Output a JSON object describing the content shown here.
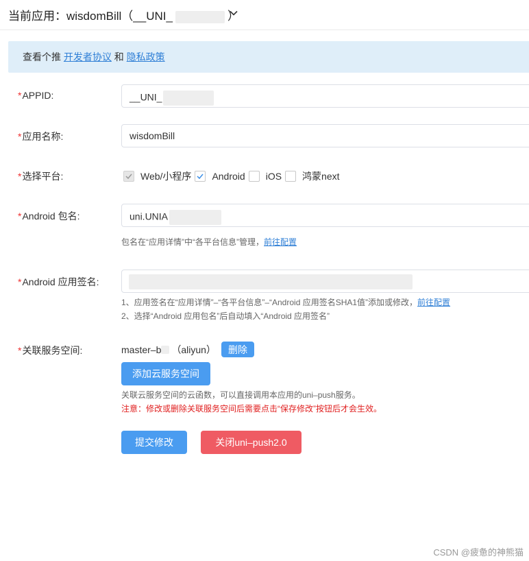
{
  "header": {
    "title_prefix": "当前应用：wisdomBill（__UNI_",
    "title_suffix": "）"
  },
  "notice": {
    "text": "查看个推",
    "link1": "开发者协议",
    "and": "和",
    "link2": "隐私政策"
  },
  "form": {
    "appid": {
      "label": "APPID:",
      "value": "__UNI_"
    },
    "app_name": {
      "label": "应用名称:",
      "value": "wisdomBill"
    },
    "platform": {
      "label": "选择平台:",
      "options": [
        {
          "label": "Web/小程序",
          "state": "checked-disabled"
        },
        {
          "label": "Android",
          "state": "checked"
        },
        {
          "label": "iOS",
          "state": "unchecked"
        },
        {
          "label": "鸿蒙next",
          "state": "unchecked"
        }
      ]
    },
    "package": {
      "label": "Android 包名:",
      "value": "uni.UNIA",
      "hint_text": "包名在“应用详情”中“各平台信息”管理，",
      "hint_link": "前往配置"
    },
    "signature": {
      "label": "Android 应用签名:",
      "hint1_text": "1、应用签名在“应用详情”–“各平台信息”–“Android 应用签名SHA1值”添加或修改，",
      "hint1_link": "前往配置",
      "hint2_text": "2、选择“Android 应用包名”后自动填入“Android 应用签名”"
    },
    "service_space": {
      "label": "关联服务空间:",
      "name_prefix": "master–b",
      "provider": "（aliyun）",
      "delete_label": "删除",
      "add_label": "添加云服务空间",
      "hint": "关联云服务空间的云函数，可以直接调用本应用的uni–push服务。",
      "warning": "注意：修改或删除关联服务空间后需要点击“保存修改”按钮后才会生效。"
    }
  },
  "actions": {
    "submit_label": "提交修改",
    "close_label": "关闭uni–push2.0"
  },
  "footer": {
    "watermark": "CSDN @疲惫的神熊猫"
  },
  "colors": {
    "primary": "#4a9cf0",
    "danger": "#ef5b63",
    "link": "#2f7fd6",
    "notice_bg": "#dfeef9",
    "required": "#e33"
  }
}
